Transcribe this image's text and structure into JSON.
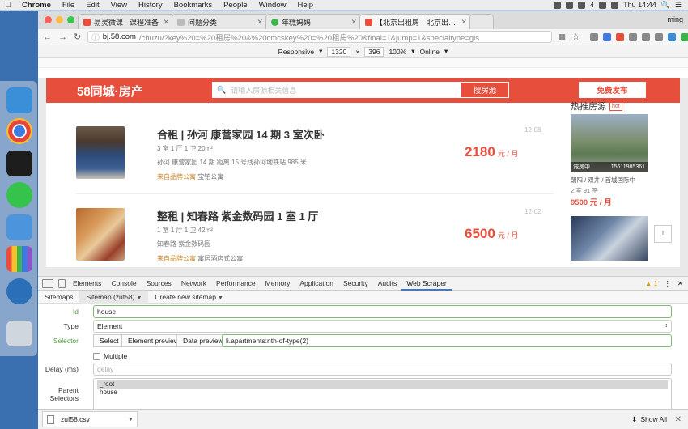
{
  "menubar": {
    "items": [
      "Chrome",
      "File",
      "Edit",
      "View",
      "History",
      "Bookmarks",
      "People",
      "Window",
      "Help"
    ],
    "battery": "4",
    "time": "Thu 14:44"
  },
  "tabs": [
    {
      "title": "易灵微课 - 课程准备",
      "color": "#e84e3c"
    },
    {
      "title": "问题分类",
      "color": "#bbbbbb"
    },
    {
      "title": "年糕妈妈",
      "color": "#3cb54a"
    },
    {
      "title": "【北京出租房｜北京出租房网｜",
      "color": "#e84e3c"
    }
  ],
  "user": "ming",
  "address": {
    "host": "bj.58.com",
    "path": "/chuzu/?key%20=%20租房%20&%20cmcskey%20=%20租房%20&final=1&jump=1&specialtype=gls"
  },
  "device": {
    "mode": "Responsive",
    "width": "1320",
    "height": "396",
    "zoom": "100%",
    "network": "Online"
  },
  "site": {
    "logo": "58同城·房产",
    "search_placeholder": "请输入房源相关信息",
    "search_button": "搜房源",
    "publish_button": "免费发布"
  },
  "listings": [
    {
      "title": "合租 | 孙河 康营家园 14 期 3 室次卧",
      "info1": "3 室 1 厅 1 卫    20m²",
      "info2": "孙河 康营家园 14 期    距离 15 号线孙河地铁站 985 米",
      "tag": "来自品牌公寓",
      "brand": "宝铂公寓",
      "price": "2180",
      "unit": "元 / 月",
      "date": "12-08"
    },
    {
      "title": "整租 | 知春路 紫金数码园 1 室 1 厅",
      "info1": "1 室 1 厅 1 卫    42m²",
      "info2": "知春路 紫金数码园",
      "tag": "来自品牌公寓",
      "brand": "寓居酒店式公寓",
      "price": "6500",
      "unit": "元 / 月",
      "date": "12-02"
    }
  ],
  "sidebar": {
    "heading": "热推房源",
    "hot": "hot",
    "caption_left": "诚房中",
    "caption_right": "15611985361",
    "name": "朝阳 / 双井 / 首城国际中",
    "detail": "2 室    91 平",
    "price": "9500 元 / 月"
  },
  "devtools": {
    "tabs": [
      "Elements",
      "Console",
      "Sources",
      "Network",
      "Performance",
      "Memory",
      "Application",
      "Security",
      "Audits",
      "Web Scraper"
    ],
    "warnings": "1",
    "scraper_nav": [
      "Sitemaps",
      "Sitemap (zuf58)",
      "Create new sitemap"
    ],
    "form": {
      "id_label": "Id",
      "id_value": "house",
      "type_label": "Type",
      "type_value": "Element",
      "selector_label": "Selector",
      "select_button": "Select",
      "element_preview_button": "Element preview",
      "data_preview_button": "Data preview",
      "selector_value": "li.apartments:nth-of-type(2)",
      "multiple_label": "Multiple",
      "delay_label": "Delay (ms)",
      "delay_placeholder": "delay",
      "parent_label": "Parent Selectors",
      "parents": [
        "_root",
        "house"
      ]
    }
  },
  "download": {
    "file": "zuf58.csv",
    "show_all": "Show All"
  }
}
